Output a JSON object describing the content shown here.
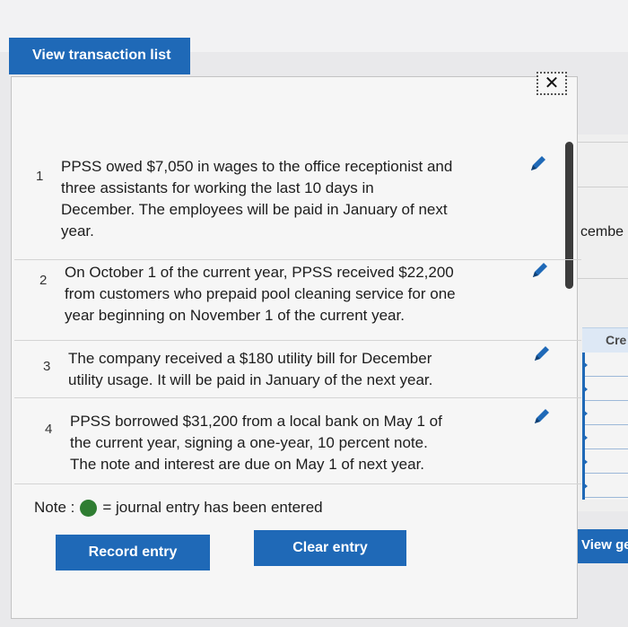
{
  "tab": {
    "label": "View transaction list"
  },
  "close": {
    "glyph": "✕"
  },
  "transactions": [
    {
      "num": "1",
      "lines": [
        "PPSS owed $7,050 in wages to the office receptionist and",
        "three assistants for working the last 10 days in",
        "December. The employees will be paid in January of next",
        "year."
      ]
    },
    {
      "num": "2",
      "lines": [
        "On October 1 of the current year, PPSS received $22,200",
        "from customers who prepaid pool cleaning service for one",
        "year beginning on November 1 of the current year."
      ]
    },
    {
      "num": "3",
      "lines": [
        "The company received a $180 utility bill for December",
        "utility usage. It will be paid in January of the next year."
      ]
    },
    {
      "num": "4",
      "lines": [
        "PPSS borrowed $31,200 from a local bank on May 1 of",
        "the current year, signing a one-year, 10 percent note.",
        "The note and interest are due on May 1 of next year."
      ]
    }
  ],
  "note": {
    "label": "Note :",
    "text": "= journal entry has been entered"
  },
  "buttons": {
    "record": "Record entry",
    "clear": "Clear entry",
    "view": "View ge"
  },
  "background": {
    "cembe": "cembe",
    "cre": "Cre"
  },
  "colors": {
    "accent": "#1f69b7",
    "entered_dot": "#2f7d32"
  },
  "icons": {
    "edit": "pencil-icon",
    "close": "close-icon"
  }
}
